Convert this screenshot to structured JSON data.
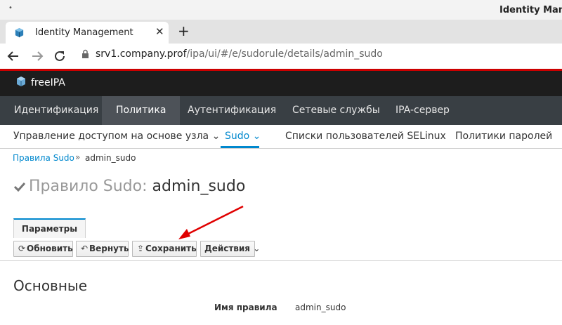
{
  "window": {
    "title": "Identity Mana"
  },
  "browser": {
    "tab_title": "Identity Management",
    "close_glyph": "✕",
    "new_tab_glyph": "+",
    "url_host": "srv1.company.prof",
    "url_path": "/ipa/ui/#/e/sudorule/details/admin_sudo",
    "icons": {
      "back": "arrow-left-icon",
      "forward": "arrow-right-icon",
      "reload": "reload-icon",
      "lock": "lock-icon"
    }
  },
  "app": {
    "brand": "freeIPA",
    "main_nav": [
      "Идентификация",
      "Политика",
      "Аутентификация",
      "Сетевые службы",
      "IPA-сервер"
    ],
    "main_nav_active": "Политика",
    "sub_nav": [
      "Управление доступом на основе узла",
      "Sudo",
      "Списки пользователей SELinux",
      "Политики паролей"
    ],
    "sub_nav_active": "Sudo",
    "chevron": "⌄"
  },
  "breadcrumb": {
    "parent": "Правила Sudo",
    "separator": "»",
    "current": "admin_sudo"
  },
  "page": {
    "title_prefix": "Правило Sudo:",
    "title_name": "admin_sudo"
  },
  "section_tab": "Параметры",
  "toolbar": {
    "refresh_label": "Обновить",
    "revert_label": "Вернуть",
    "save_label": "Сохранить",
    "actions_label": "Действия"
  },
  "section": {
    "title": "Основные",
    "field_label": "Имя правила",
    "field_value": "admin_sudo"
  },
  "colors": {
    "accent": "#0088ce",
    "annotation_arrow": "#e00000",
    "header_line": "#cc0000"
  }
}
